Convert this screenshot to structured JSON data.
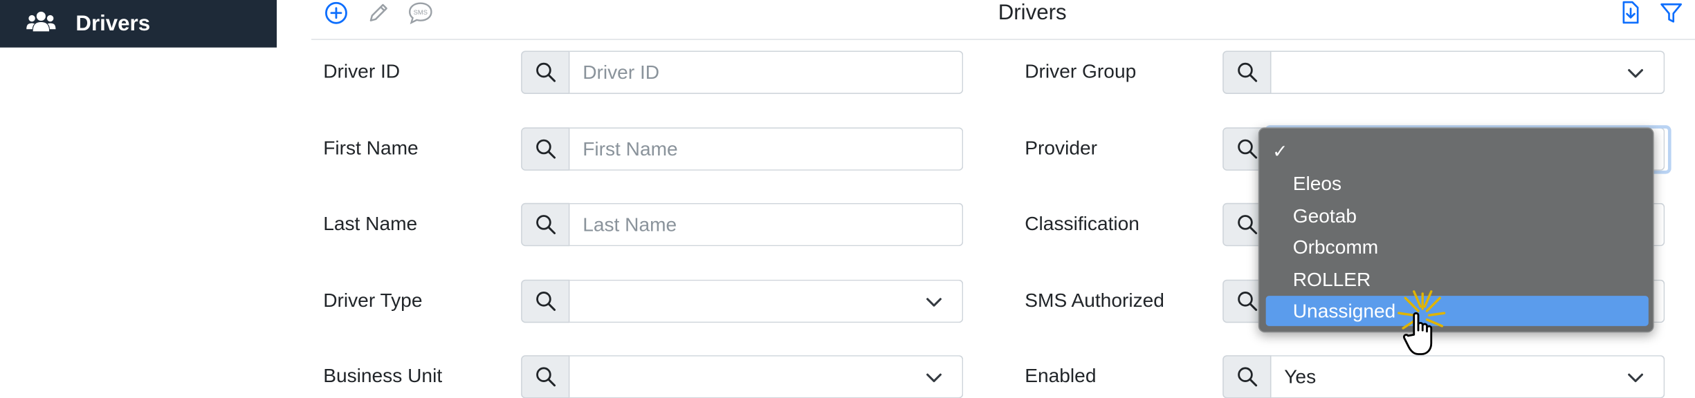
{
  "sidebar": {
    "title": "Drivers",
    "icon": "users-icon"
  },
  "toolbar": {
    "title": "Drivers",
    "icons": [
      "add-circle-icon",
      "pencil-icon",
      "sms-icon",
      "download-icon",
      "filter-icon"
    ],
    "sms_text": "SMS"
  },
  "form": {
    "driver_id": {
      "label": "Driver ID",
      "placeholder": "Driver ID",
      "value": ""
    },
    "first_name": {
      "label": "First Name",
      "placeholder": "First Name",
      "value": ""
    },
    "last_name": {
      "label": "Last Name",
      "placeholder": "Last Name",
      "value": ""
    },
    "driver_type": {
      "label": "Driver Type",
      "value": ""
    },
    "business_unit": {
      "label": "Business Unit",
      "value": ""
    },
    "driver_group": {
      "label": "Driver Group",
      "value": ""
    },
    "provider": {
      "label": "Provider",
      "value": ""
    },
    "classification": {
      "label": "Classification",
      "value": ""
    },
    "sms_authorized": {
      "label": "SMS Authorized",
      "value": ""
    },
    "enabled": {
      "label": "Enabled",
      "value": "Yes"
    }
  },
  "provider_dropdown": {
    "checked_index": 0,
    "highlighted": "Unassigned",
    "options": [
      "",
      "Eleos",
      "Geotab",
      "Orbcomm",
      "ROLLER",
      "Unassigned"
    ]
  },
  "colors": {
    "sidebar_bg": "#1e2a38",
    "accent": "#0d6efd",
    "menu_bg": "#6b6d6e",
    "menu_highlight": "#5b9cec"
  }
}
